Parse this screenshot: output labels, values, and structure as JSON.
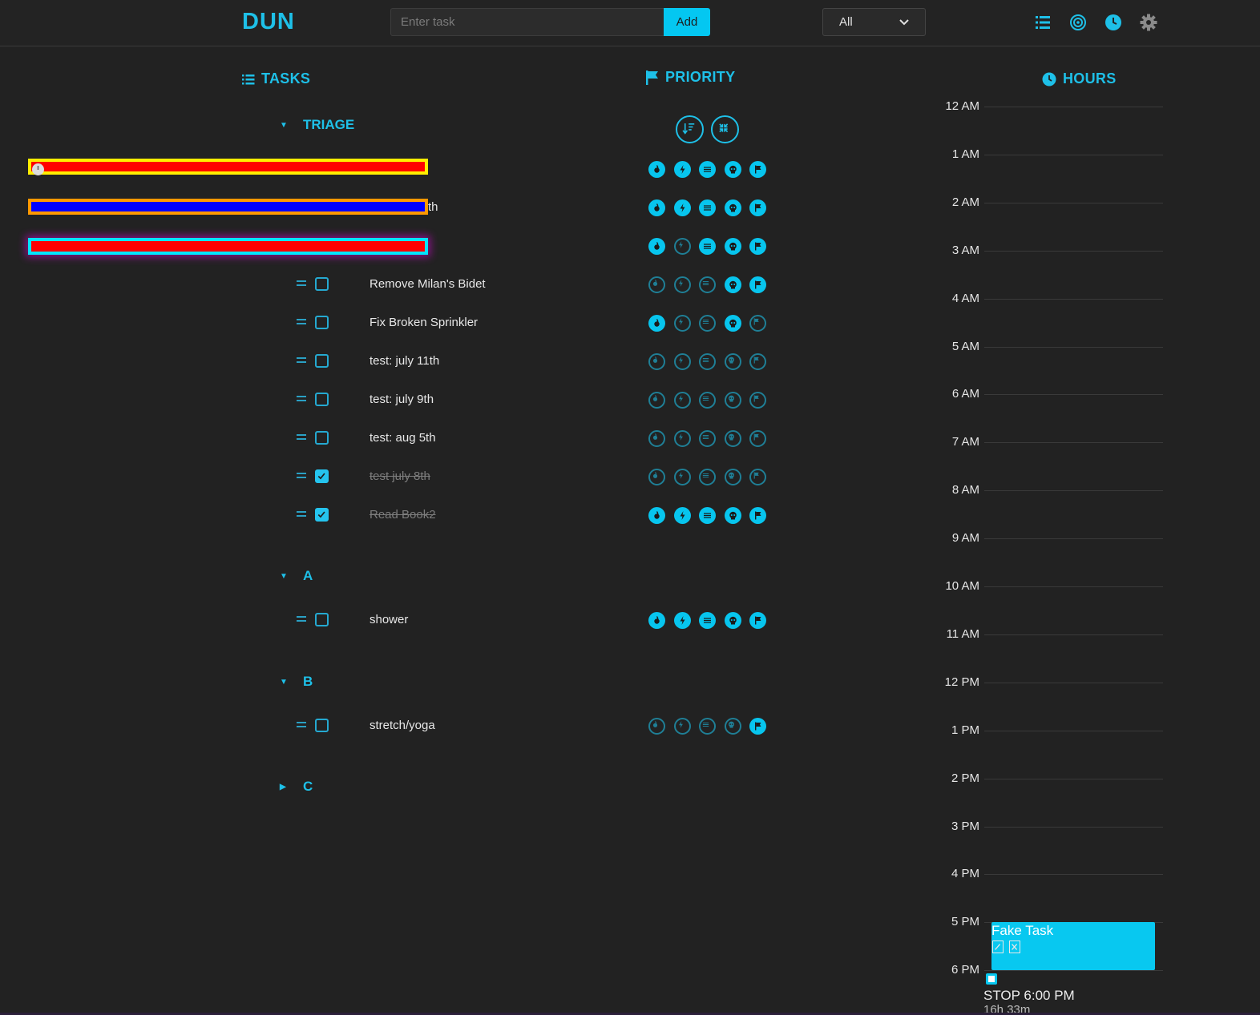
{
  "header": {
    "logo": "DUN",
    "task_placeholder": "Enter task",
    "add_label": "Add",
    "filter_value": "All",
    "icons": [
      "list-icon",
      "target-icon",
      "clock-icon",
      "gear-icon"
    ]
  },
  "sections": {
    "tasks": "TASKS",
    "priority": "PRIORITY",
    "hours": "HOURS"
  },
  "groups": [
    {
      "name": "TRIAGE",
      "expanded": true,
      "tasks": [
        {
          "name": "th",
          "done": false,
          "priorities": [
            true,
            true,
            true,
            true,
            true
          ]
        },
        {
          "name": "",
          "done": false,
          "priorities": [
            true,
            false,
            true,
            true,
            true
          ]
        },
        {
          "name": "Remove Milan's Bidet",
          "done": false,
          "priorities": [
            false,
            false,
            false,
            true,
            true
          ]
        },
        {
          "name": "Fix Broken Sprinkler",
          "done": false,
          "priorities": [
            true,
            false,
            false,
            true,
            false
          ]
        },
        {
          "name": "test: july 11th",
          "done": false,
          "priorities": [
            false,
            false,
            false,
            false,
            false
          ]
        },
        {
          "name": "test: july 9th",
          "done": false,
          "priorities": [
            false,
            false,
            false,
            false,
            false
          ]
        },
        {
          "name": "test: aug 5th",
          "done": false,
          "priorities": [
            false,
            false,
            false,
            false,
            false
          ]
        },
        {
          "name": "test july 8th",
          "done": true,
          "priorities": [
            false,
            false,
            false,
            false,
            false
          ]
        },
        {
          "name": "Read Book2",
          "done": true,
          "priorities": [
            true,
            true,
            true,
            true,
            true
          ]
        }
      ],
      "first_row_priorities": [
        true,
        true,
        true,
        true,
        true
      ]
    },
    {
      "name": "A",
      "expanded": true,
      "tasks": [
        {
          "name": "shower",
          "done": false,
          "priorities": [
            true,
            true,
            true,
            true,
            true
          ]
        }
      ]
    },
    {
      "name": "B",
      "expanded": true,
      "tasks": [
        {
          "name": "stretch/yoga",
          "done": false,
          "priorities": [
            false,
            false,
            false,
            false,
            true
          ]
        }
      ]
    },
    {
      "name": "C",
      "expanded": false,
      "tasks": []
    }
  ],
  "priority_icons": [
    "flame-icon",
    "bolt-icon",
    "waves-icon",
    "skull-icon",
    "flag-icon"
  ],
  "hours": [
    "12 AM",
    "1 AM",
    "2 AM",
    "3 AM",
    "4 AM",
    "5 AM",
    "6 AM",
    "7 AM",
    "8 AM",
    "9 AM",
    "10 AM",
    "11 AM",
    "12 PM",
    "1 PM",
    "2 PM",
    "3 PM",
    "4 PM",
    "5 PM",
    "6 PM"
  ],
  "event": {
    "title": "Fake Task",
    "stop_label": "STOP 6:00 PM",
    "elapsed": "16h 33m"
  },
  "colors": {
    "accent": "#1ec0e8",
    "background": "#222222",
    "highlight_bars": [
      "#ffee00",
      "#ff9900",
      "#00e5ff"
    ]
  }
}
